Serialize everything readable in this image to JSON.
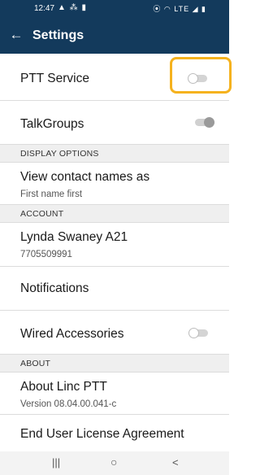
{
  "status_bar": {
    "time": "12:47",
    "left_icons": "▲ ⁂ ▮",
    "right_icons": "⦿ ◠ LTE ◢ ▮"
  },
  "app_bar": {
    "back_glyph": "←",
    "title": "Settings"
  },
  "rows": {
    "ptt_service": {
      "label": "PTT Service",
      "toggle": "off"
    },
    "talkgroups": {
      "label": "TalkGroups",
      "toggle": "on-disabled"
    },
    "view_contact_names": {
      "label": "View contact names as",
      "value": "First name first"
    },
    "account_name": {
      "label": "Lynda Swaney A21",
      "value": "7705509991"
    },
    "notifications": {
      "label": "Notifications"
    },
    "wired_accessories": {
      "label": "Wired Accessories",
      "toggle": "off"
    },
    "about_linc": {
      "label": "About Linc PTT",
      "value": "Version 08.04.00.041-c"
    },
    "eula": {
      "label": "End User License Agreement"
    }
  },
  "sections": {
    "display_options": "DISPLAY OPTIONS",
    "account": "ACCOUNT",
    "about": "ABOUT"
  },
  "nav_bar": {
    "recents": "|||",
    "home": "○",
    "back": "<"
  },
  "colors": {
    "app_bar": "#133a5c",
    "highlight": "#f5b21e",
    "section_bg": "#efefef"
  }
}
